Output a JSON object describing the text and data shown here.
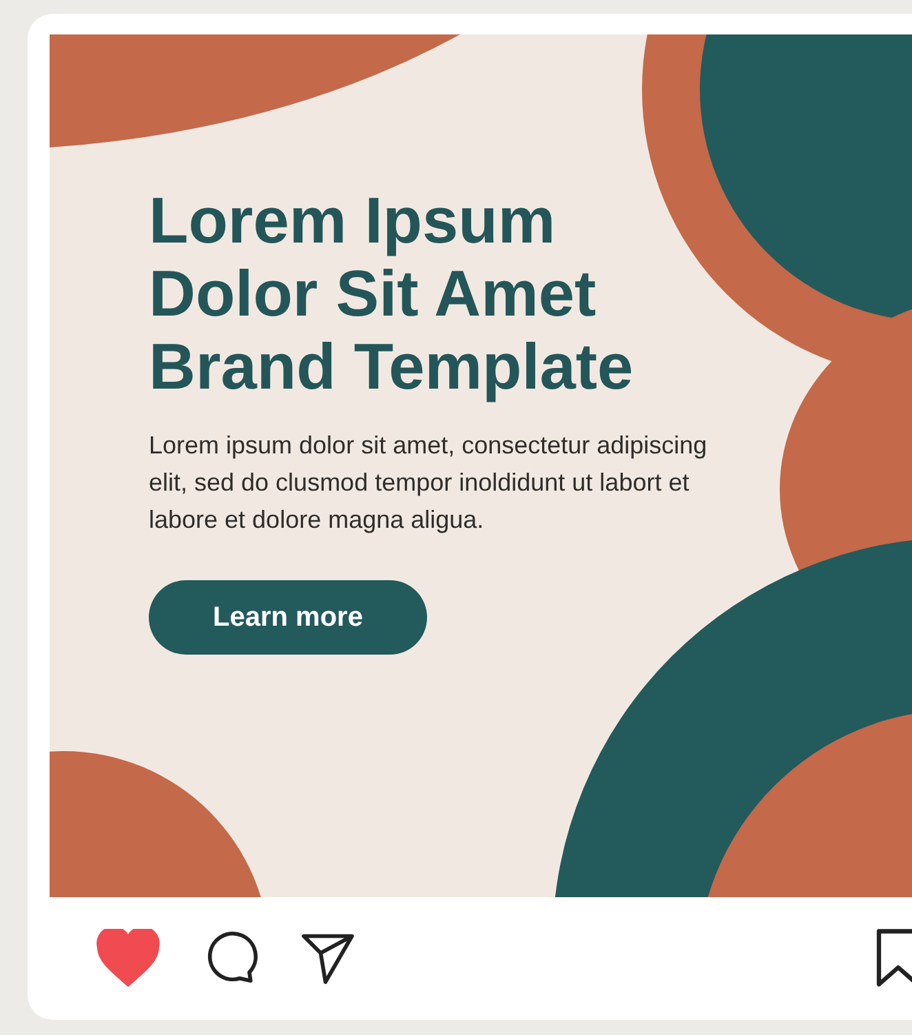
{
  "post": {
    "headline_lines": [
      "Lorem Ipsum",
      "Dolor Sit Amet",
      "Brand Template"
    ],
    "body": "Lorem ipsum dolor sit amet, consectetur adipiscing elit, sed do clusmod tempor inoldidunt ut labort et labore et dolore magna aligua.",
    "button": "Learn more"
  },
  "actions": {
    "liked": true,
    "saved": false
  }
}
